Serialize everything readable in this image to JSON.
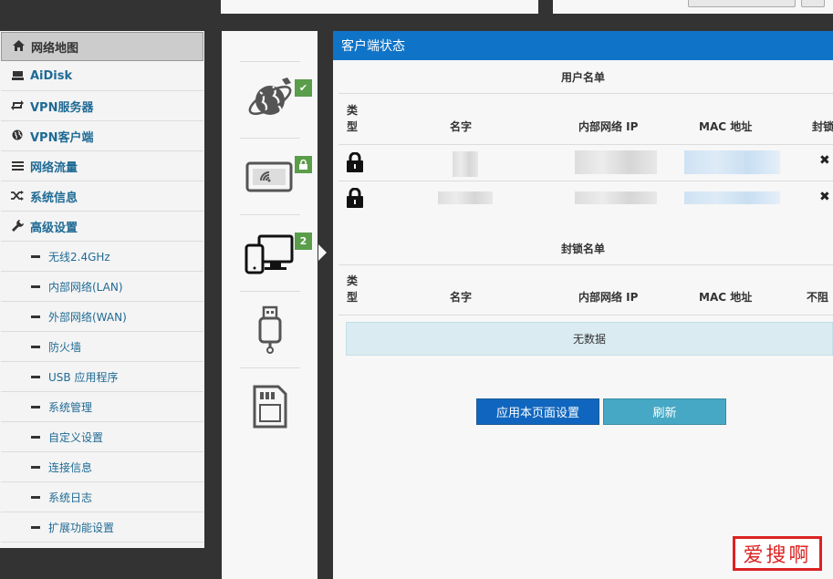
{
  "sidebar": {
    "menu": [
      {
        "label": "网络地图",
        "icon": "home-icon",
        "active": true
      },
      {
        "label": "AiDisk",
        "icon": "disk-icon"
      },
      {
        "label": "VPN服务器",
        "icon": "exchange-icon"
      },
      {
        "label": "VPN客户端",
        "icon": "globe-icon"
      },
      {
        "label": "网络流量",
        "icon": "list-icon"
      },
      {
        "label": "系统信息",
        "icon": "shuffle-icon"
      },
      {
        "label": "高级设置",
        "icon": "wrench-icon"
      }
    ],
    "submenu": [
      "无线2.4GHz",
      "内部网络(LAN)",
      "外部网络(WAN)",
      "防火墙",
      "USB 应用程序",
      "系统管理",
      "自定义设置",
      "连接信息",
      "系统日志",
      "扩展功能设置"
    ]
  },
  "status_icons": {
    "clients_badge": "2",
    "colors": {
      "badge": "#5a9d4a",
      "accent": "#0f74c8"
    }
  },
  "panel": {
    "title": "客户端状态",
    "user_list": {
      "title": "用户名单",
      "columns": {
        "type": "类\n型",
        "name": "名字",
        "ip": "内部网络 IP",
        "mac": "MAC 地址",
        "block": "封锁"
      }
    },
    "block_list": {
      "title": "封锁名单",
      "columns": {
        "type": "类\n型",
        "name": "名字",
        "ip": "内部网络 IP",
        "mac": "MAC 地址",
        "unblock": "不阻"
      },
      "empty_text": "无数据"
    },
    "buttons": {
      "apply": "应用本页面设置",
      "refresh": "刷新"
    }
  },
  "watermark": "爱搜啊"
}
